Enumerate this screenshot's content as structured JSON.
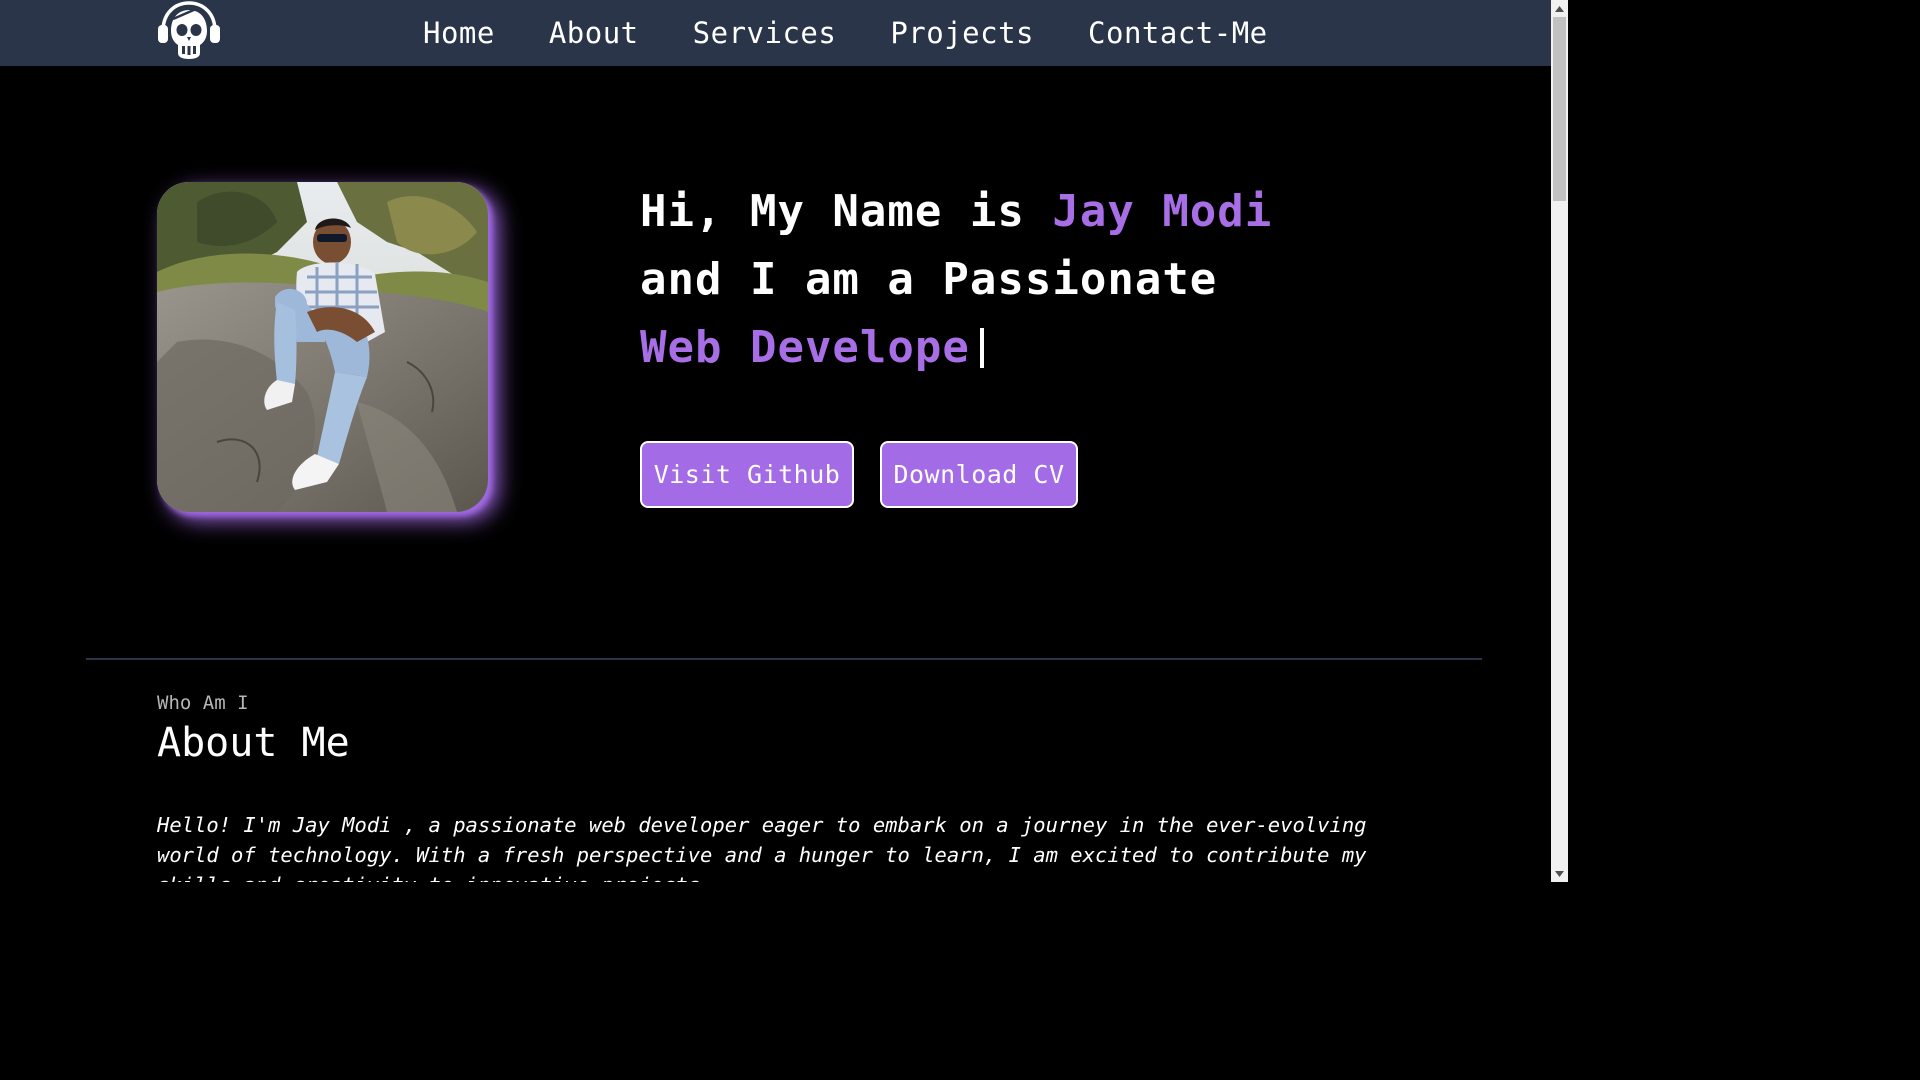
{
  "nav": {
    "logo_icon": "skull-headphones-logo-icon",
    "links": [
      "Home",
      "About",
      "Services",
      "Projects",
      "Contact-Me"
    ]
  },
  "hero": {
    "line1_prefix": "Hi, My Name is ",
    "line1_name": "Jay Modi",
    "line2": "and I am a Passionate",
    "line3_typed": "Web Develope",
    "github_button": "Visit Github",
    "cv_button": "Download CV"
  },
  "about": {
    "kicker": "Who Am I",
    "title": "About Me",
    "body": "Hello! I'm Jay Modi , a passionate web developer eager to embark on a journey in the ever-evolving world of technology. With a fresh perspective and a hunger to learn, I am excited to contribute my skills and creativity to innovative projects."
  },
  "colors": {
    "nav_bg": "#2a3549",
    "accent": "#a46be6",
    "page_bg": "#000000"
  }
}
